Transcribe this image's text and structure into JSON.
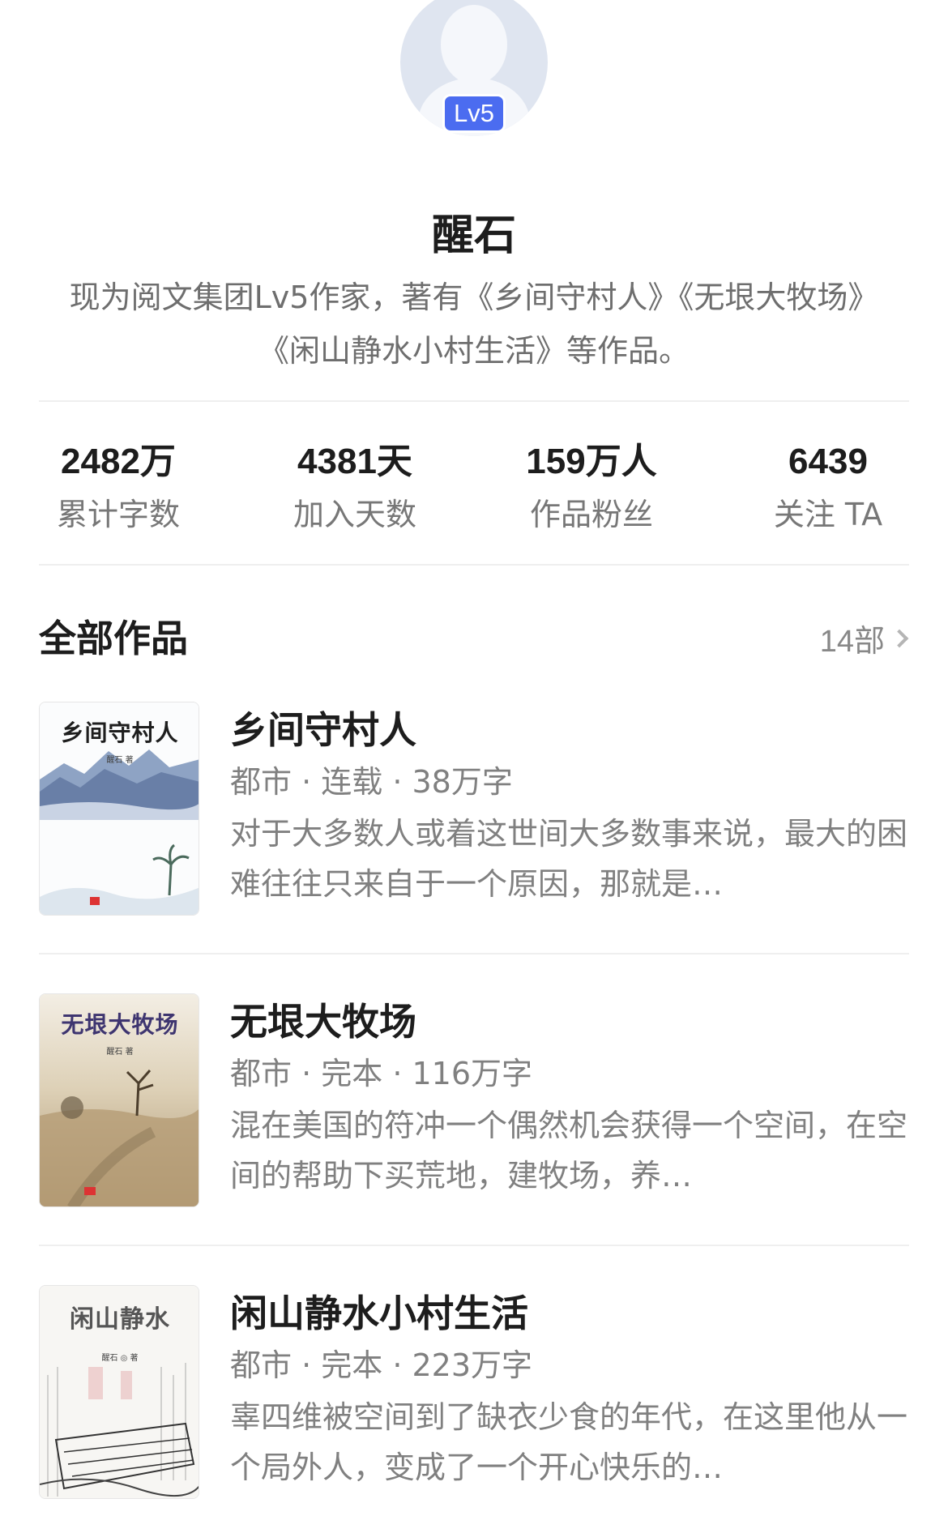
{
  "profile": {
    "level_badge": "Lv5",
    "name": "醒石",
    "intro": "现为阅文集团Lv5作家，著有《乡间守村人》《无垠大牧场》《闲山静水小村生活》等作品。"
  },
  "stats": [
    {
      "value": "2482万",
      "label": "累计字数"
    },
    {
      "value": "4381天",
      "label": "加入天数"
    },
    {
      "value": "159万人",
      "label": "作品粉丝"
    },
    {
      "value": "6439",
      "label": "关注 TA"
    }
  ],
  "works_section": {
    "title": "全部作品",
    "count": "14部"
  },
  "books": [
    {
      "title": "乡间守村人",
      "cover_title": "乡间守村人",
      "cover_author": "醒石 著",
      "genre": "都市",
      "status": "连载",
      "words": "38万字",
      "meta": "都市 · 连载 · 38万字",
      "description": "对于大多数人或着这世间大多数事来说，最大的困难往往只来自于一个原因，那就是…",
      "cover_color": "#24346b"
    },
    {
      "title": "无垠大牧场",
      "cover_title": "无垠大牧场",
      "cover_author": "醒石 著",
      "genre": "都市",
      "status": "完本",
      "words": "116万字",
      "meta": "都市 · 完本 · 116万字",
      "description": "混在美国的符冲一个偶然机会获得一个空间，在空间的帮助下买荒地，建牧场，养…",
      "cover_color": "#3e3570"
    },
    {
      "title": "闲山静水小村生活",
      "cover_title": "闲山静水",
      "cover_author": "醒石 ◎ 著",
      "genre": "都市",
      "status": "完本",
      "words": "223万字",
      "meta": "都市 · 完本 · 223万字",
      "description": "辜四维被空间到了缺衣少食的年代，在这里他从一个局外人，变成了一个开心快乐的…",
      "cover_color": "#555555"
    }
  ]
}
